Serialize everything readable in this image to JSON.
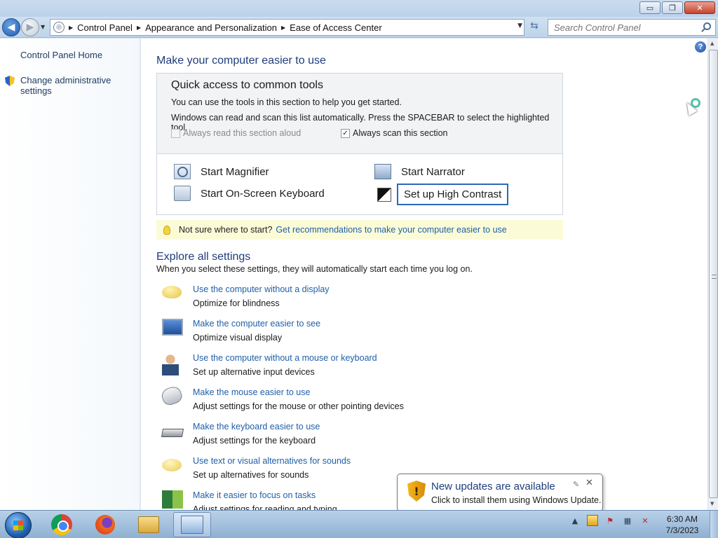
{
  "window": {
    "controls": {
      "minimize": "▭",
      "maximize": "❐",
      "close": "✕"
    }
  },
  "nav": {
    "back_glyph": "◀",
    "forward_glyph": "▶",
    "breadcrumb": [
      "Control Panel",
      "Appearance and Personalization",
      "Ease of Access Center"
    ],
    "search_placeholder": "Search Control Panel"
  },
  "sidebar": {
    "items": [
      {
        "label": "Control Panel Home"
      },
      {
        "label": "Change administrative settings",
        "icon": "uac-shield-icon"
      }
    ]
  },
  "main": {
    "heading": "Make your computer easier to use",
    "quick_access": {
      "title": "Quick access to common tools",
      "line1": "You can use the tools in this section to help you get started.",
      "line2": "Windows can read and scan this list automatically.  Press the SPACEBAR to select the highlighted tool.",
      "checkbox_read": {
        "label": "Always read this section aloud",
        "checked": false,
        "disabled": true
      },
      "checkbox_scan": {
        "label": "Always scan this section",
        "checked": true
      },
      "tools": [
        {
          "label": "Start Magnifier",
          "icon": "magnifier-icon"
        },
        {
          "label": "Start Narrator",
          "icon": "narrator-icon"
        },
        {
          "label": "Start On-Screen Keyboard",
          "icon": "keyboard-icon"
        },
        {
          "label": "Set up High Contrast",
          "icon": "contrast-icon",
          "highlighted": true
        }
      ]
    },
    "tip": {
      "prefix": "Not sure where to start?",
      "link": "Get recommendations to make your computer easier to use"
    },
    "explore": {
      "heading": "Explore all settings",
      "subtitle": "When you select these settings, they will automatically start each time you log on.",
      "items": [
        {
          "link": "Use the computer without a display",
          "desc": "Optimize for blindness",
          "icon": "speech-bubble-icon"
        },
        {
          "link": "Make the computer easier to see",
          "desc": "Optimize visual display",
          "icon": "monitor-icon"
        },
        {
          "link": "Use the computer without a mouse or keyboard",
          "desc": "Set up alternative input devices",
          "icon": "person-icon"
        },
        {
          "link": "Make the mouse easier to use",
          "desc": "Adjust settings for the mouse or other pointing devices",
          "icon": "mouse-icon"
        },
        {
          "link": "Make the keyboard easier to use",
          "desc": "Adjust settings for the keyboard",
          "icon": "keyboard-icon"
        },
        {
          "link": "Use text or visual alternatives for sounds",
          "desc": "Set up alternatives for sounds",
          "icon": "sound-bubble-icon"
        },
        {
          "link": "Make it easier to focus on tasks",
          "desc": "Adjust settings for reading and typing",
          "icon": "focus-icon"
        }
      ]
    }
  },
  "notification": {
    "title": "New updates are available",
    "text": "Click to install them using Windows Update.",
    "close": "✕"
  },
  "taskbar": {
    "apps": [
      "chrome-icon",
      "firefox-icon",
      "explorer-icon",
      "control-panel-icon"
    ],
    "tray_arrow": "▲",
    "time": "6:30 AM",
    "date": "7/3/2023"
  }
}
